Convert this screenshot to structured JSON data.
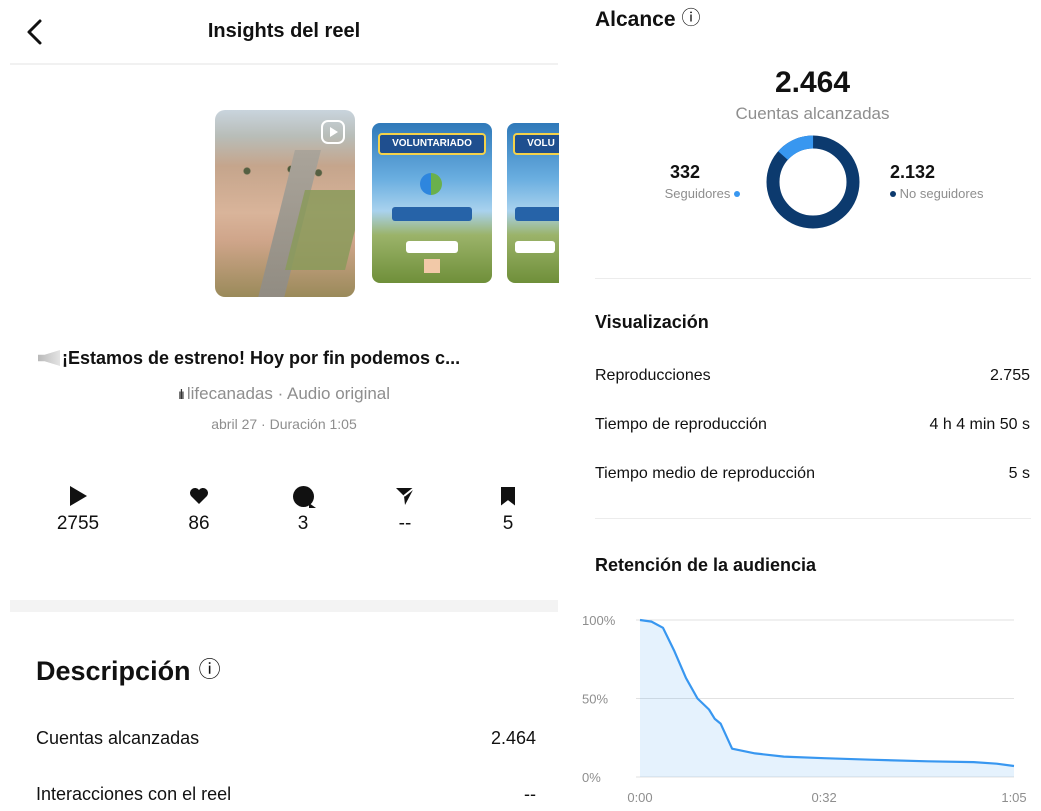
{
  "header": {
    "title": "Insights del reel"
  },
  "reel": {
    "caption": "¡Estamos de estreno! Hoy por fin podemos c...",
    "audio": "lifecanadas · Audio original",
    "meta": "abril 27 · Duración 1:05",
    "poster_text_1": "VOLUNTARIADO",
    "poster_text_2": "VOLU"
  },
  "stats": {
    "plays": "2755",
    "likes": "86",
    "comments": "3",
    "shares": "--",
    "saves": "5"
  },
  "description": {
    "title": "Descripción",
    "info_icon": "ⓘ",
    "rows": [
      {
        "label": "Cuentas alcanzadas",
        "value": "2.464"
      },
      {
        "label": "Interacciones con el reel",
        "value": "--"
      }
    ]
  },
  "reach": {
    "title": "Alcance",
    "total": "2.464",
    "total_label": "Cuentas alcanzadas",
    "followers_value": "332",
    "followers_label": "Seguidores",
    "non_followers_value": "2.132",
    "non_followers_label": "No seguidores",
    "followers_fraction": 0.135,
    "followers_color": "#3897f0",
    "non_followers_color": "#0c3a6e"
  },
  "visualization": {
    "title": "Visualización",
    "rows": [
      {
        "label": "Reproducciones",
        "value": "2.755"
      },
      {
        "label": "Tiempo de reproducción",
        "value": "4 h 4 min 50 s"
      },
      {
        "label": "Tiempo medio de reproducción",
        "value": "5 s"
      }
    ]
  },
  "retention": {
    "title": "Retención de la audiencia"
  },
  "chart_data": {
    "type": "area",
    "ylabel": "",
    "xlabel": "",
    "ylim": [
      0,
      100
    ],
    "xlim": [
      0,
      65
    ],
    "y_ticks": [
      "100%",
      "50%",
      "0%"
    ],
    "x_ticks": [
      "0:00",
      "0:32",
      "1:05"
    ],
    "x_tick_values": [
      0,
      32,
      65
    ],
    "y_tick_values": [
      100,
      50,
      0
    ],
    "series": [
      {
        "color": "#3897f0",
        "x": [
          0,
          2,
          4,
          6,
          8,
          10,
          12,
          13,
          14,
          16,
          20,
          25,
          32,
          40,
          50,
          58,
          62,
          65
        ],
        "y": [
          100,
          99,
          95,
          80,
          63,
          50,
          43,
          37,
          34,
          18,
          15,
          13,
          12,
          11,
          10,
          9.5,
          8.5,
          7
        ]
      }
    ]
  }
}
